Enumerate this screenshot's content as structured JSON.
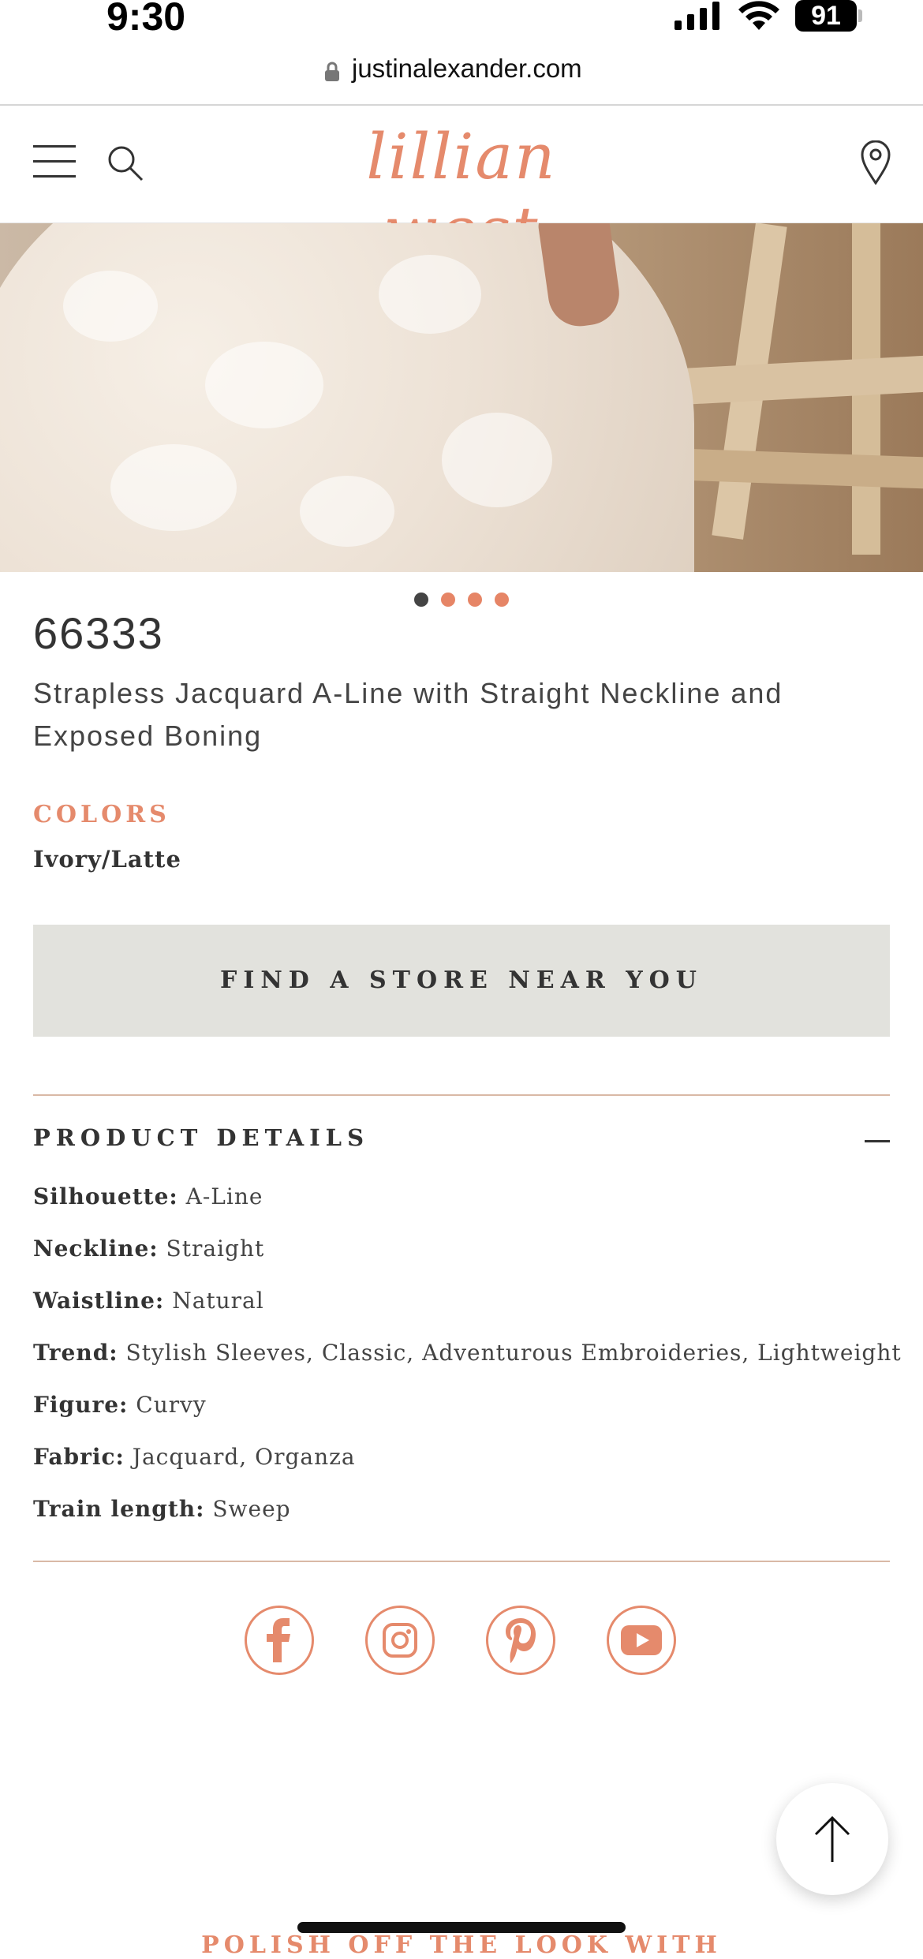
{
  "status_bar": {
    "time": "9:30",
    "battery": "91"
  },
  "browser": {
    "url": "justinalexander.com"
  },
  "header": {
    "logo": "lillian west"
  },
  "carousel": {
    "total_slides": 4,
    "active_index": 0
  },
  "product": {
    "code": "66333",
    "title": "Strapless Jacquard A-Line with Straight Neckline and Exposed Boning",
    "colors_label": "COLORS",
    "colors_value": "Ivory/Latte",
    "find_store_label": "FIND A STORE NEAR YOU"
  },
  "details": {
    "header": "PRODUCT DETAILS",
    "rows": [
      {
        "label": "Silhouette:",
        "value": "A-Line"
      },
      {
        "label": "Neckline:",
        "value": "Straight"
      },
      {
        "label": "Waistline:",
        "value": "Natural"
      },
      {
        "label": "Trend:",
        "value": "Stylish Sleeves, Classic, Adventurous Embroideries, Lightweight"
      },
      {
        "label": "Figure:",
        "value": "Curvy"
      },
      {
        "label": "Fabric:",
        "value": "Jacquard, Organza"
      },
      {
        "label": "Train length:",
        "value": "Sweep"
      }
    ]
  },
  "social": [
    "facebook-icon",
    "instagram-icon",
    "pinterest-icon",
    "youtube-icon"
  ],
  "footer": {
    "polish_heading": "POLISH OFF THE LOOK WITH"
  },
  "colors": {
    "accent": "#e58a6c",
    "button_bg": "#e2e2dd",
    "text": "#333333"
  }
}
